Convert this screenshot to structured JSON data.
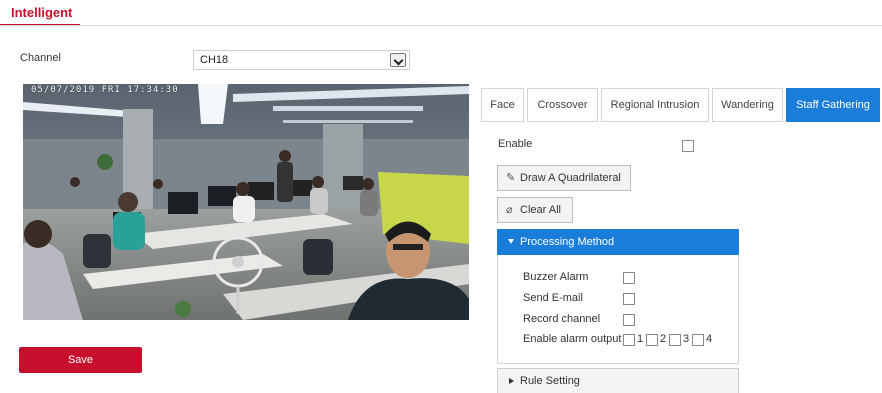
{
  "nav": {
    "active_tab": "Intelligent"
  },
  "channel": {
    "label": "Channel",
    "value": "CH18"
  },
  "video": {
    "osd": "05/07/2019 FRI 17:34:30"
  },
  "detection_tabs": [
    {
      "label": "Face",
      "active": false
    },
    {
      "label": "Crossover",
      "active": false
    },
    {
      "label": "Regional Intrusion",
      "active": false
    },
    {
      "label": "Wandering",
      "active": false
    },
    {
      "label": "Staff Gathering",
      "active": true
    }
  ],
  "enable": {
    "label": "Enable",
    "checked": false
  },
  "actions": {
    "draw_label": "Draw A Quadrilateral",
    "clear_label": "Clear All"
  },
  "processing": {
    "title": "Processing Method",
    "buzzer_label": "Buzzer Alarm",
    "email_label": "Send E-mail",
    "record_label": "Record channel",
    "alarm_output_label": "Enable alarm output",
    "alarm_outputs": [
      "1",
      "2",
      "3",
      "4"
    ]
  },
  "rule_setting": {
    "title": "Rule Setting"
  },
  "save_label": "Save",
  "colors": {
    "accent": "#c8102e",
    "tab_active": "#1a7dda"
  }
}
